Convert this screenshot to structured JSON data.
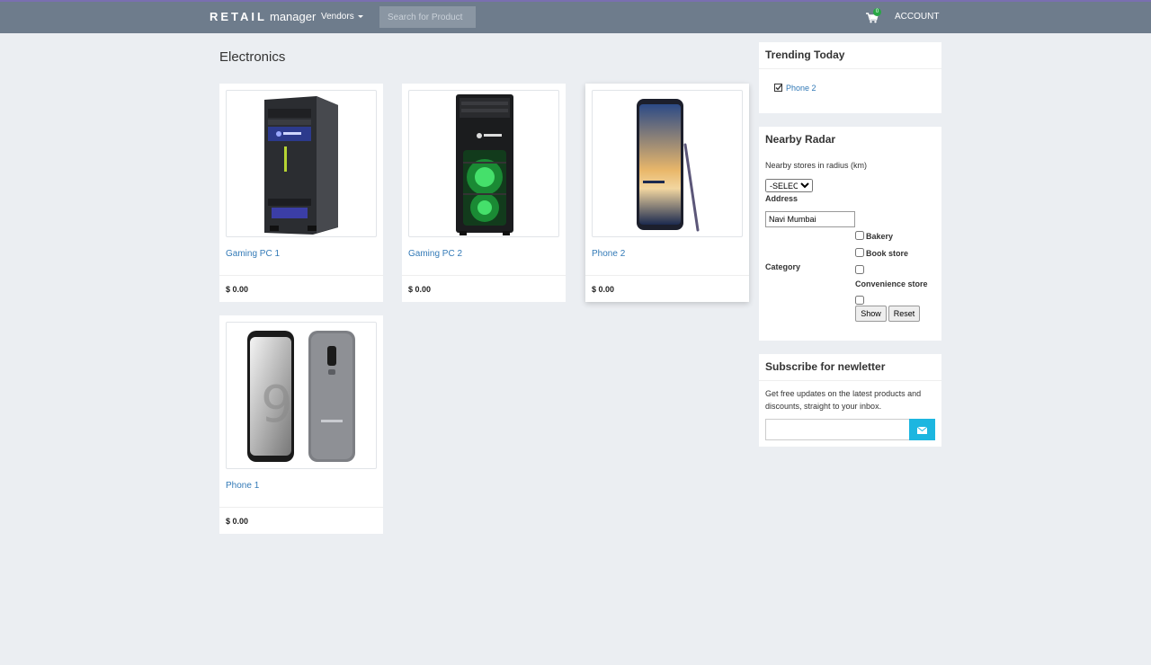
{
  "navbar": {
    "brand_bold": "RETAIL",
    "brand_light": "manager",
    "vendors_label": "Vendors",
    "search_placeholder": "Search for Product",
    "cart_count": "0",
    "account_label": "ACCOUNT"
  },
  "main": {
    "title": "Electronics",
    "products": [
      {
        "name": "Gaming PC 1",
        "price": "$ 0.00",
        "image": "gaming-pc-tower"
      },
      {
        "name": "Gaming PC 2",
        "price": "$ 0.00",
        "image": "gaming-pc-tower-green"
      },
      {
        "name": "Phone 2",
        "price": "$ 0.00",
        "image": "smartphone-with-stylus"
      },
      {
        "name": "Phone 1",
        "price": "$ 0.00",
        "image": "smartphone-front-back"
      }
    ]
  },
  "sidebar": {
    "trending": {
      "title": "Trending Today",
      "items": [
        "Phone 2"
      ]
    },
    "radar": {
      "title": "Nearby Radar",
      "radius_label": "Nearby stores in radius (km)",
      "radius_selected": "-SELECT-",
      "address_label": "Address",
      "address_value": "Navi Mumbai",
      "category_label": "Category",
      "categories": [
        "Bakery",
        "Book store",
        "Convenience store"
      ],
      "show_label": "Show",
      "reset_label": "Reset"
    },
    "newsletter": {
      "title": "Subscribe for newletter",
      "text": "Get free updates on the latest products and discounts, straight to your inbox.",
      "email_value": "",
      "send_icon": "envelope-icon"
    }
  },
  "colors": {
    "navbar": "#6e7c8c",
    "background": "#ebeef2",
    "link": "#337ab7",
    "send_button": "#1cb6e0",
    "badge": "#28a745"
  }
}
